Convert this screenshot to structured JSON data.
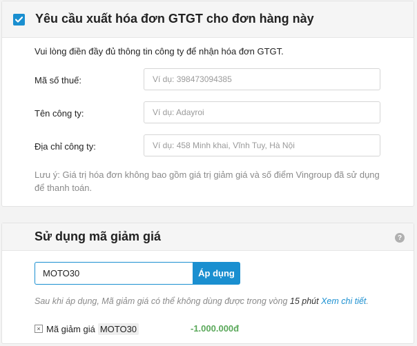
{
  "invoice": {
    "checked": true,
    "title": "Yêu cầu xuất hóa đơn GTGT cho đơn hàng này",
    "intro": "Vui lòng điền đầy đủ thông tin công ty để nhận hóa đơn GTGT.",
    "fields": [
      {
        "label": "Mã số thuế:",
        "placeholder": "Ví dụ: 398473094385",
        "value": ""
      },
      {
        "label": "Tên công ty:",
        "placeholder": "Ví dụ: Adayroi",
        "value": ""
      },
      {
        "label": "Địa chỉ công ty:",
        "placeholder": "Ví dụ: 458 Minh khai, Vĩnh Tuy, Hà Nội",
        "value": ""
      }
    ],
    "note": "Lưu ý: Giá trị hóa đơn không bao gồm giá trị giảm giá và số điểm Vingroup đã sử dụng để thanh toán."
  },
  "coupon": {
    "title": "Sử dụng mã giảm giá",
    "help_icon": "?",
    "input_value": "MOTO30",
    "apply_label": "Áp dụng",
    "note_prefix": "Sau khi áp dụng, Mã giảm giá có thể không dùng được trong vòng ",
    "note_duration": "15 phút",
    "note_link": "Xem chi tiết",
    "note_suffix": ".",
    "applied": {
      "remove_icon": "×",
      "label": "Mã giảm giá",
      "code": "MOTO30",
      "amount": "-1.000.000đ"
    }
  },
  "colors": {
    "accent": "#1a8fd0",
    "discount": "#5aa85a",
    "muted": "#8a8a8a"
  }
}
